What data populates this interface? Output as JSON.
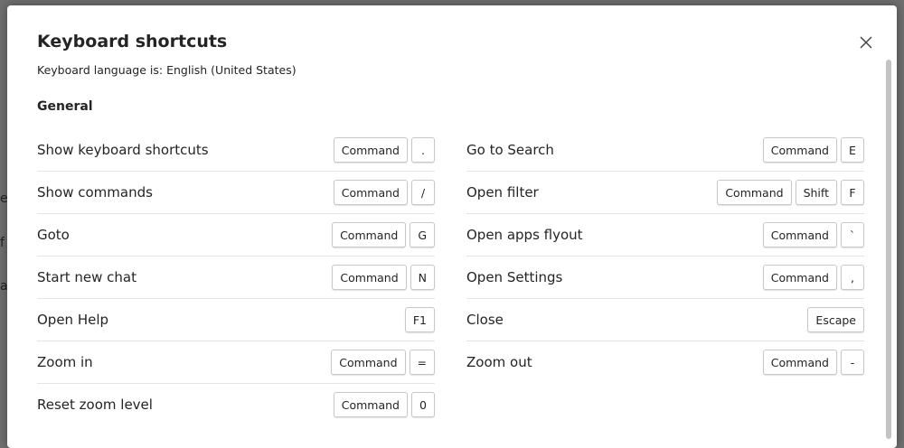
{
  "dialog": {
    "title": "Keyboard shortcuts",
    "subtitle": "Keyboard language is: English (United States)",
    "close_icon": "close-icon",
    "section_title": "General"
  },
  "left_shortcuts": [
    {
      "label": "Show keyboard shortcuts",
      "keys": [
        "Command",
        "."
      ]
    },
    {
      "label": "Show commands",
      "keys": [
        "Command",
        "/"
      ]
    },
    {
      "label": "Goto",
      "keys": [
        "Command",
        "G"
      ]
    },
    {
      "label": "Start new chat",
      "keys": [
        "Command",
        "N"
      ]
    },
    {
      "label": "Open Help",
      "keys": [
        "F1"
      ]
    },
    {
      "label": "Zoom in",
      "keys": [
        "Command",
        "="
      ]
    },
    {
      "label": "Reset zoom level",
      "keys": [
        "Command",
        "0"
      ]
    }
  ],
  "right_shortcuts": [
    {
      "label": "Go to Search",
      "keys": [
        "Command",
        "E"
      ]
    },
    {
      "label": "Open filter",
      "keys": [
        "Command",
        "Shift",
        "F"
      ]
    },
    {
      "label": "Open apps flyout",
      "keys": [
        "Command",
        "`"
      ]
    },
    {
      "label": "Open Settings",
      "keys": [
        "Command",
        ","
      ]
    },
    {
      "label": "Close",
      "keys": [
        "Escape"
      ]
    },
    {
      "label": "Zoom out",
      "keys": [
        "Command",
        "-"
      ]
    }
  ],
  "background_fragments": [
    "e",
    "f",
    "a"
  ]
}
